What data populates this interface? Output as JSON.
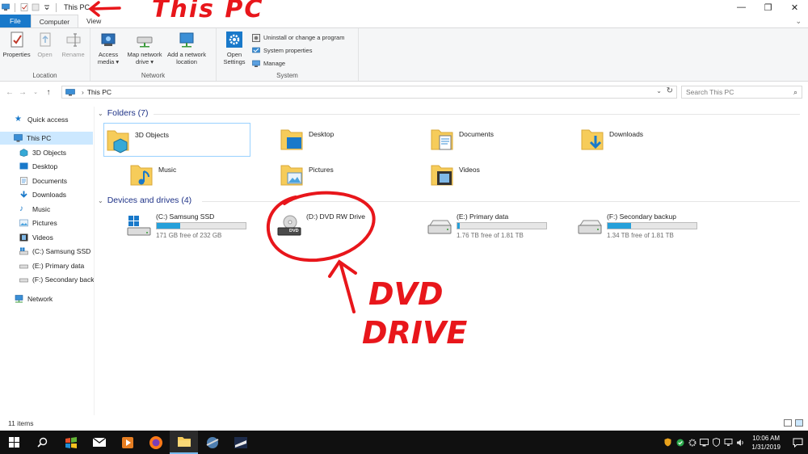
{
  "window": {
    "title": "This PC",
    "controls": {
      "minimize": "—",
      "maximize": "❐",
      "close": "✕"
    }
  },
  "ribbon_tabs": [
    {
      "label": "File"
    },
    {
      "label": "Computer"
    },
    {
      "label": "View"
    }
  ],
  "ribbon": {
    "location": {
      "label": "Location",
      "properties": "Properties",
      "open": "Open",
      "rename": "Rename"
    },
    "network": {
      "label": "Network",
      "access_media": "Access media ▾",
      "map_network_drive": "Map network drive ▾",
      "add_network_location": "Add a network location"
    },
    "system": {
      "label": "System",
      "open_settings": "Open Settings",
      "uninstall": "Uninstall or change a program",
      "system_properties": "System properties",
      "manage": "Manage"
    }
  },
  "address": {
    "path": "This PC",
    "search_placeholder": "Search This PC"
  },
  "sidebar": {
    "quick_access": "Quick access",
    "this_pc": "This PC",
    "items": [
      "3D Objects",
      "Desktop",
      "Documents",
      "Downloads",
      "Music",
      "Pictures",
      "Videos",
      "(C:) Samsung SSD",
      "(E:) Primary data",
      "(F:) Secondary back"
    ],
    "network": "Network"
  },
  "folders": {
    "heading": "Folders (7)",
    "items": [
      "3D Objects",
      "Desktop",
      "Documents",
      "Downloads",
      "Music",
      "Pictures",
      "Videos"
    ]
  },
  "drives": {
    "heading": "Devices and drives (4)",
    "items": [
      {
        "name": "(C:) Samsung SSD",
        "free": "171 GB free of 232 GB",
        "used_fraction": 0.26
      },
      {
        "name": "(D:) DVD RW Drive"
      },
      {
        "name": "(E:) Primary data",
        "free": "1.76 TB free of 1.81 TB",
        "used_fraction": 0.03
      },
      {
        "name": "(F:) Secondary backup",
        "free": "1.34 TB free of 1.81 TB",
        "used_fraction": 0.26
      }
    ],
    "dvd_badge": "DVD"
  },
  "status": {
    "items": "11 items"
  },
  "taskbar": {
    "time": "10:06 AM",
    "date": "1/31/2019"
  },
  "annotations": {
    "this_pc": "This PC",
    "dvd": "DVD",
    "drive": "DRIVE"
  },
  "colors": {
    "accent": "#1979ca",
    "selection": "#cce8ff",
    "section_heading": "#1e3287",
    "capacity_bar": "#26a0da",
    "annotation": "#e8161b"
  }
}
